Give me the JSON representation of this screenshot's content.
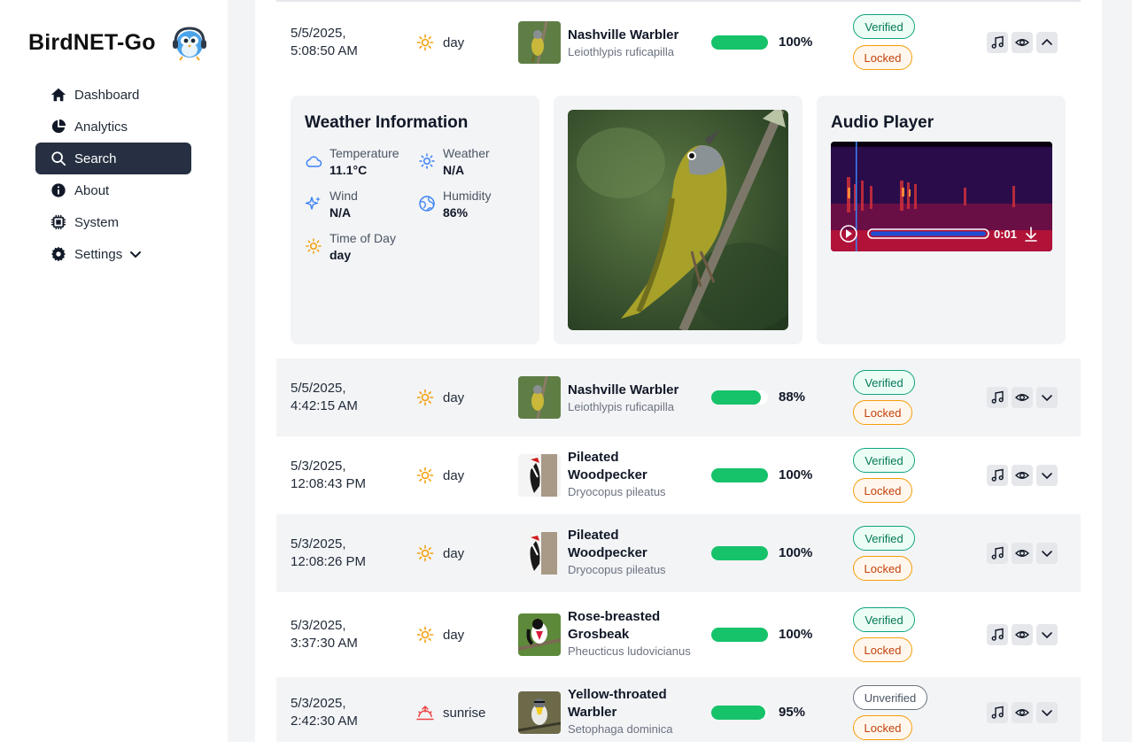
{
  "app": {
    "title": "BirdNET-Go"
  },
  "nav": [
    {
      "label": "Dashboard",
      "icon": "home-icon"
    },
    {
      "label": "Analytics",
      "icon": "pie-chart-icon"
    },
    {
      "label": "Search",
      "icon": "search-icon",
      "active": true
    },
    {
      "label": "About",
      "icon": "info-icon"
    },
    {
      "label": "System",
      "icon": "cpu-icon"
    },
    {
      "label": "Settings",
      "icon": "gear-icon",
      "has_submenu": true
    }
  ],
  "expanded": {
    "date": "5/5/2025,",
    "time": "5:08:50 AM",
    "time_of_day": "day",
    "common": "Nashville Warbler",
    "scientific": "Leiothlypis ruficapilla",
    "confidence": 100,
    "confidence_label": "100%",
    "status": "Verified",
    "lock": "Locked",
    "weather": {
      "title": "Weather Information",
      "temperature_label": "Temperature",
      "temperature": "11.1°C",
      "weather_label": "Weather",
      "weather": "N/A",
      "wind_label": "Wind",
      "wind": "N/A",
      "humidity_label": "Humidity",
      "humidity": "86%",
      "tod_label": "Time of Day",
      "tod": "day"
    },
    "audio": {
      "title": "Audio Player",
      "time": "0:01"
    }
  },
  "rows": [
    {
      "date": "5/5/2025,",
      "time": "4:42:15 AM",
      "tod": "day",
      "common": "Nashville Warbler",
      "scientific": "Leiothlypis ruficapilla",
      "confidence": 88,
      "confidence_label": "88%",
      "status": "Verified",
      "lock": "Locked"
    },
    {
      "date": "5/3/2025,",
      "time": "12:08:43 PM",
      "tod": "day",
      "common": "Pileated Woodpecker",
      "scientific": "Dryocopus pileatus",
      "confidence": 100,
      "confidence_label": "100%",
      "status": "Verified",
      "lock": "Locked"
    },
    {
      "date": "5/3/2025,",
      "time": "12:08:26 PM",
      "tod": "day",
      "common": "Pileated Woodpecker",
      "scientific": "Dryocopus pileatus",
      "confidence": 100,
      "confidence_label": "100%",
      "status": "Verified",
      "lock": "Locked"
    },
    {
      "date": "5/3/2025,",
      "time": "3:37:30 AM",
      "tod": "day",
      "common": "Rose-breasted Grosbeak",
      "scientific": "Pheucticus ludovicianus",
      "confidence": 100,
      "confidence_label": "100%",
      "status": "Verified",
      "lock": "Locked"
    },
    {
      "date": "5/3/2025,",
      "time": "2:42:30 AM",
      "tod": "sunrise",
      "common": "Yellow-throated Warbler",
      "scientific": "Setophaga dominica",
      "confidence": 95,
      "confidence_label": "95%",
      "status": "Unverified",
      "lock": "Locked"
    }
  ],
  "colors": {
    "accent": "#263042",
    "confidence": "#16c26a",
    "verified": "#10a37f",
    "locked": "#f59e0b",
    "sun": "#f59e0b",
    "weather_icon": "#3b82f6"
  }
}
